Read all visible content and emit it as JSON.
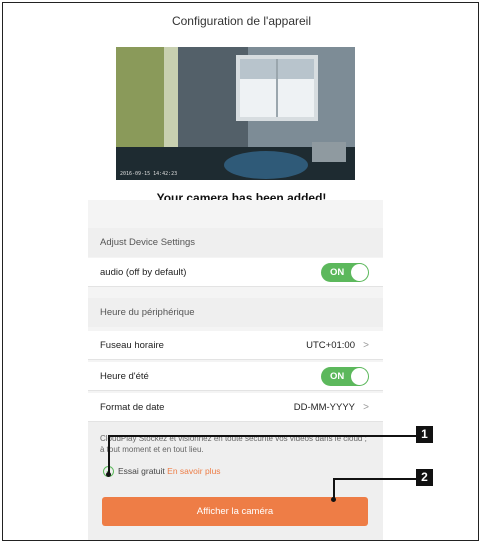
{
  "header": {
    "title": "Configuration de l'appareil"
  },
  "preview": {
    "timestamp": "2016-09-15 14:42:23"
  },
  "confirmation": "Your camera has been added!",
  "sections": {
    "device_settings": "Adjust Device Settings",
    "device_time": "Heure du périphérique"
  },
  "settings": {
    "audio": {
      "label": "audio (off by default)",
      "state": "ON"
    },
    "timezone": {
      "label": "Fuseau horaire",
      "value": "UTC+01:00"
    },
    "dst": {
      "label": "Heure d'été",
      "state": "ON"
    },
    "date_format": {
      "label": "Format de date",
      "value": "DD-MM-YYYY"
    }
  },
  "promo": {
    "text": "CloudPlay Stockez et visionnez en toute sécurité vos vidéos dans le cloud ; à tout moment et en tout lieu.",
    "trial_label": "Essai gratuit",
    "learn_more": "En savoir plus"
  },
  "show_camera_button": "Afficher la caméra",
  "callouts": [
    "1",
    "2"
  ],
  "colors": {
    "toggle_on": "#5cb85c",
    "accent": "#ee7d46",
    "section_bg": "#efefef"
  }
}
